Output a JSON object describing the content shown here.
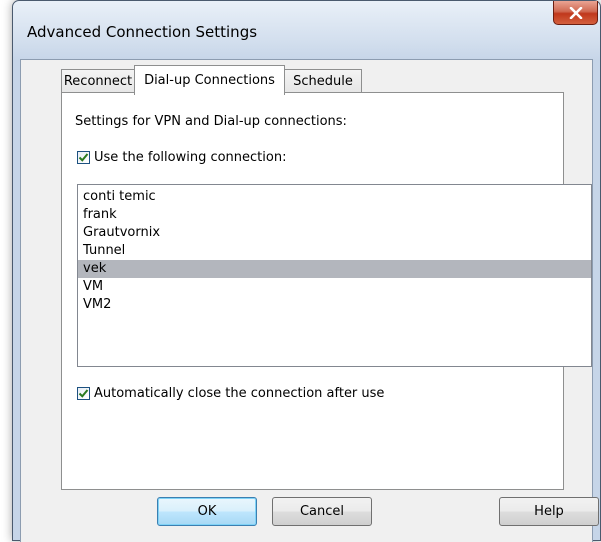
{
  "window": {
    "title": "Advanced Connection Settings",
    "close_glyph": "X"
  },
  "tabs": [
    {
      "label": "Reconnect"
    },
    {
      "label": "Dial-up Connections"
    },
    {
      "label": "Schedule"
    }
  ],
  "panel": {
    "heading": "Settings for VPN and Dial-up connections:",
    "use_connection_label": "Use the following connection:",
    "use_connection_checked": true,
    "connections": [
      "conti temic",
      "frank",
      "Grautvornix",
      "Tunnel",
      "vek",
      "VM",
      "VM2"
    ],
    "selected_connection": "vek",
    "auto_close_label": "Automatically close the connection after use",
    "auto_close_checked": true
  },
  "buttons": {
    "ok": "OK",
    "cancel": "Cancel",
    "help": "Help"
  },
  "colors": {
    "selection": "#b3b6bd",
    "close_button": "#c0381c",
    "title_bar": "#d3dfee"
  }
}
